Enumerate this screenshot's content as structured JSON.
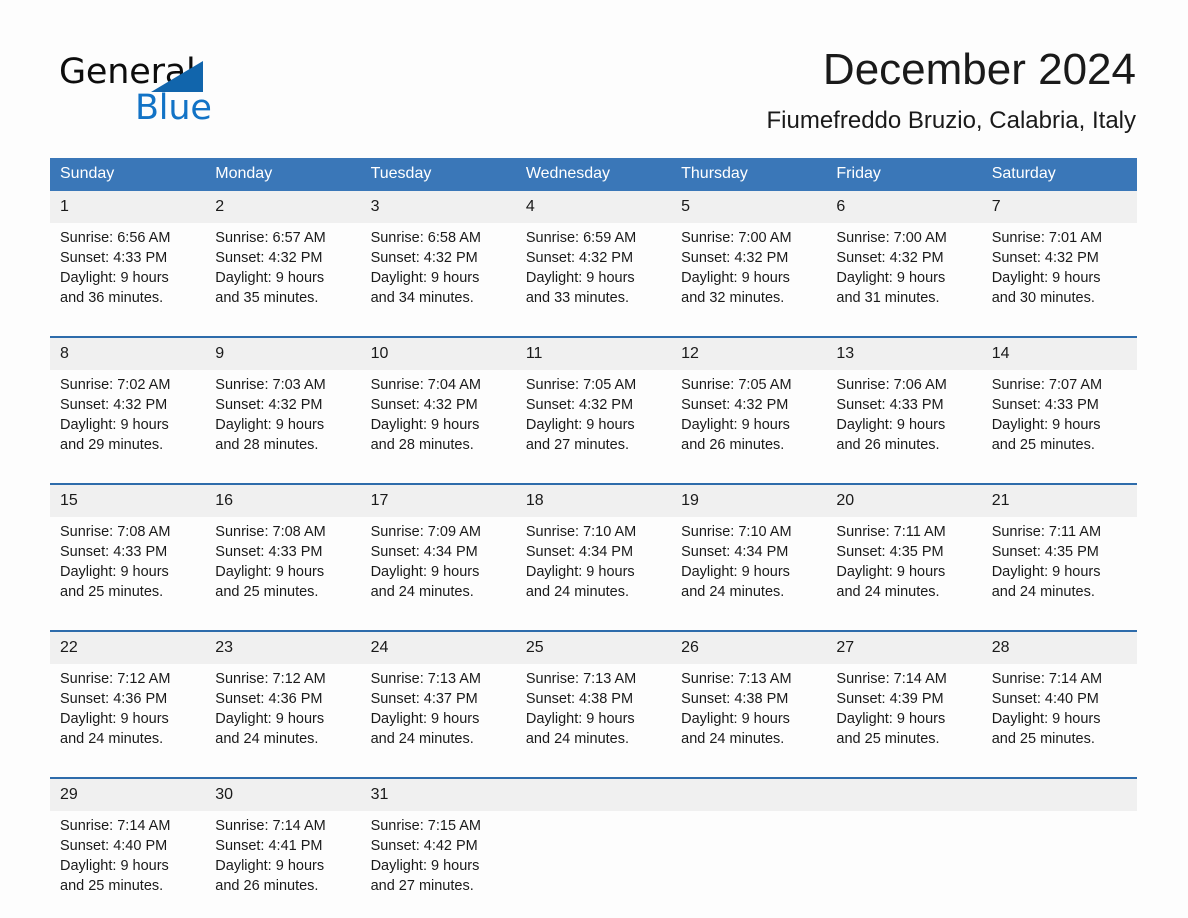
{
  "brand": {
    "word1": "General",
    "word2": "Blue",
    "accent_color": "#1273c6",
    "triangle_color": "#1165ac"
  },
  "header": {
    "title": "December 2024",
    "subtitle": "Fiumefreddo Bruzio, Calabria, Italy"
  },
  "theme": {
    "header_blue": "#3a77b8",
    "separator_blue": "#2e6cab",
    "daynum_band": "#f0f0f0",
    "page_bg": "#fdfdfd"
  },
  "weekdays": [
    "Sunday",
    "Monday",
    "Tuesday",
    "Wednesday",
    "Thursday",
    "Friday",
    "Saturday"
  ],
  "weeks": [
    [
      {
        "day": "1",
        "sunrise": "Sunrise: 6:56 AM",
        "sunset": "Sunset: 4:33 PM",
        "daylight1": "Daylight: 9 hours",
        "daylight2": "and 36 minutes."
      },
      {
        "day": "2",
        "sunrise": "Sunrise: 6:57 AM",
        "sunset": "Sunset: 4:32 PM",
        "daylight1": "Daylight: 9 hours",
        "daylight2": "and 35 minutes."
      },
      {
        "day": "3",
        "sunrise": "Sunrise: 6:58 AM",
        "sunset": "Sunset: 4:32 PM",
        "daylight1": "Daylight: 9 hours",
        "daylight2": "and 34 minutes."
      },
      {
        "day": "4",
        "sunrise": "Sunrise: 6:59 AM",
        "sunset": "Sunset: 4:32 PM",
        "daylight1": "Daylight: 9 hours",
        "daylight2": "and 33 minutes."
      },
      {
        "day": "5",
        "sunrise": "Sunrise: 7:00 AM",
        "sunset": "Sunset: 4:32 PM",
        "daylight1": "Daylight: 9 hours",
        "daylight2": "and 32 minutes."
      },
      {
        "day": "6",
        "sunrise": "Sunrise: 7:00 AM",
        "sunset": "Sunset: 4:32 PM",
        "daylight1": "Daylight: 9 hours",
        "daylight2": "and 31 minutes."
      },
      {
        "day": "7",
        "sunrise": "Sunrise: 7:01 AM",
        "sunset": "Sunset: 4:32 PM",
        "daylight1": "Daylight: 9 hours",
        "daylight2": "and 30 minutes."
      }
    ],
    [
      {
        "day": "8",
        "sunrise": "Sunrise: 7:02 AM",
        "sunset": "Sunset: 4:32 PM",
        "daylight1": "Daylight: 9 hours",
        "daylight2": "and 29 minutes."
      },
      {
        "day": "9",
        "sunrise": "Sunrise: 7:03 AM",
        "sunset": "Sunset: 4:32 PM",
        "daylight1": "Daylight: 9 hours",
        "daylight2": "and 28 minutes."
      },
      {
        "day": "10",
        "sunrise": "Sunrise: 7:04 AM",
        "sunset": "Sunset: 4:32 PM",
        "daylight1": "Daylight: 9 hours",
        "daylight2": "and 28 minutes."
      },
      {
        "day": "11",
        "sunrise": "Sunrise: 7:05 AM",
        "sunset": "Sunset: 4:32 PM",
        "daylight1": "Daylight: 9 hours",
        "daylight2": "and 27 minutes."
      },
      {
        "day": "12",
        "sunrise": "Sunrise: 7:05 AM",
        "sunset": "Sunset: 4:32 PM",
        "daylight1": "Daylight: 9 hours",
        "daylight2": "and 26 minutes."
      },
      {
        "day": "13",
        "sunrise": "Sunrise: 7:06 AM",
        "sunset": "Sunset: 4:33 PM",
        "daylight1": "Daylight: 9 hours",
        "daylight2": "and 26 minutes."
      },
      {
        "day": "14",
        "sunrise": "Sunrise: 7:07 AM",
        "sunset": "Sunset: 4:33 PM",
        "daylight1": "Daylight: 9 hours",
        "daylight2": "and 25 minutes."
      }
    ],
    [
      {
        "day": "15",
        "sunrise": "Sunrise: 7:08 AM",
        "sunset": "Sunset: 4:33 PM",
        "daylight1": "Daylight: 9 hours",
        "daylight2": "and 25 minutes."
      },
      {
        "day": "16",
        "sunrise": "Sunrise: 7:08 AM",
        "sunset": "Sunset: 4:33 PM",
        "daylight1": "Daylight: 9 hours",
        "daylight2": "and 25 minutes."
      },
      {
        "day": "17",
        "sunrise": "Sunrise: 7:09 AM",
        "sunset": "Sunset: 4:34 PM",
        "daylight1": "Daylight: 9 hours",
        "daylight2": "and 24 minutes."
      },
      {
        "day": "18",
        "sunrise": "Sunrise: 7:10 AM",
        "sunset": "Sunset: 4:34 PM",
        "daylight1": "Daylight: 9 hours",
        "daylight2": "and 24 minutes."
      },
      {
        "day": "19",
        "sunrise": "Sunrise: 7:10 AM",
        "sunset": "Sunset: 4:34 PM",
        "daylight1": "Daylight: 9 hours",
        "daylight2": "and 24 minutes."
      },
      {
        "day": "20",
        "sunrise": "Sunrise: 7:11 AM",
        "sunset": "Sunset: 4:35 PM",
        "daylight1": "Daylight: 9 hours",
        "daylight2": "and 24 minutes."
      },
      {
        "day": "21",
        "sunrise": "Sunrise: 7:11 AM",
        "sunset": "Sunset: 4:35 PM",
        "daylight1": "Daylight: 9 hours",
        "daylight2": "and 24 minutes."
      }
    ],
    [
      {
        "day": "22",
        "sunrise": "Sunrise: 7:12 AM",
        "sunset": "Sunset: 4:36 PM",
        "daylight1": "Daylight: 9 hours",
        "daylight2": "and 24 minutes."
      },
      {
        "day": "23",
        "sunrise": "Sunrise: 7:12 AM",
        "sunset": "Sunset: 4:36 PM",
        "daylight1": "Daylight: 9 hours",
        "daylight2": "and 24 minutes."
      },
      {
        "day": "24",
        "sunrise": "Sunrise: 7:13 AM",
        "sunset": "Sunset: 4:37 PM",
        "daylight1": "Daylight: 9 hours",
        "daylight2": "and 24 minutes."
      },
      {
        "day": "25",
        "sunrise": "Sunrise: 7:13 AM",
        "sunset": "Sunset: 4:38 PM",
        "daylight1": "Daylight: 9 hours",
        "daylight2": "and 24 minutes."
      },
      {
        "day": "26",
        "sunrise": "Sunrise: 7:13 AM",
        "sunset": "Sunset: 4:38 PM",
        "daylight1": "Daylight: 9 hours",
        "daylight2": "and 24 minutes."
      },
      {
        "day": "27",
        "sunrise": "Sunrise: 7:14 AM",
        "sunset": "Sunset: 4:39 PM",
        "daylight1": "Daylight: 9 hours",
        "daylight2": "and 25 minutes."
      },
      {
        "day": "28",
        "sunrise": "Sunrise: 7:14 AM",
        "sunset": "Sunset: 4:40 PM",
        "daylight1": "Daylight: 9 hours",
        "daylight2": "and 25 minutes."
      }
    ],
    [
      {
        "day": "29",
        "sunrise": "Sunrise: 7:14 AM",
        "sunset": "Sunset: 4:40 PM",
        "daylight1": "Daylight: 9 hours",
        "daylight2": "and 25 minutes."
      },
      {
        "day": "30",
        "sunrise": "Sunrise: 7:14 AM",
        "sunset": "Sunset: 4:41 PM",
        "daylight1": "Daylight: 9 hours",
        "daylight2": "and 26 minutes."
      },
      {
        "day": "31",
        "sunrise": "Sunrise: 7:15 AM",
        "sunset": "Sunset: 4:42 PM",
        "daylight1": "Daylight: 9 hours",
        "daylight2": "and 27 minutes."
      },
      {
        "day": "",
        "sunrise": "",
        "sunset": "",
        "daylight1": "",
        "daylight2": ""
      },
      {
        "day": "",
        "sunrise": "",
        "sunset": "",
        "daylight1": "",
        "daylight2": ""
      },
      {
        "day": "",
        "sunrise": "",
        "sunset": "",
        "daylight1": "",
        "daylight2": ""
      },
      {
        "day": "",
        "sunrise": "",
        "sunset": "",
        "daylight1": "",
        "daylight2": ""
      }
    ]
  ]
}
